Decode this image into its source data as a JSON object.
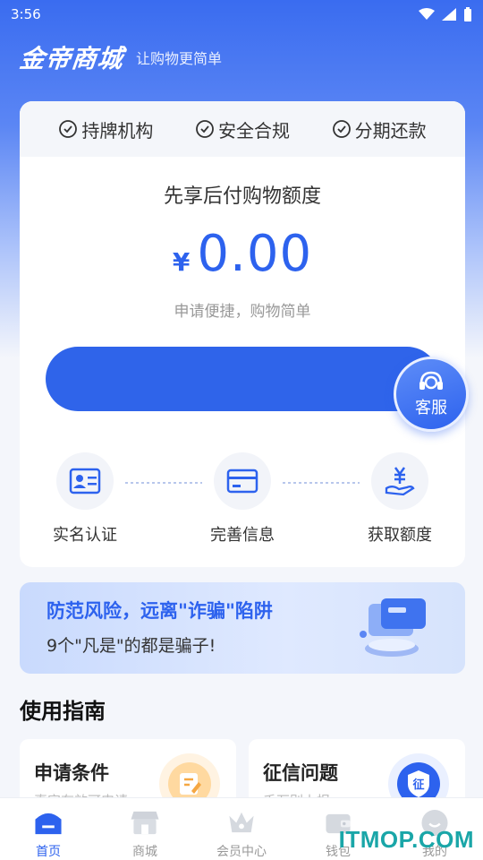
{
  "status_bar": {
    "time": "3:56"
  },
  "header": {
    "logo": "金帝商城",
    "slogan": "让购物更简单"
  },
  "badges": [
    "持牌机构",
    "安全合规",
    "分期还款"
  ],
  "quota": {
    "title": "先享后付购物额度",
    "currency": "¥",
    "amount": "0.00",
    "subtitle": "申请便捷，购物简单"
  },
  "service": {
    "label": "客服"
  },
  "steps": [
    {
      "label": "实名认证",
      "icon": "id-card-icon"
    },
    {
      "label": "完善信息",
      "icon": "card-icon"
    },
    {
      "label": "获取额度",
      "icon": "yen-hand-icon"
    }
  ],
  "warning": {
    "title": "防范风险，远离\"诈骗\"陷阱",
    "subtitle": "9个\"凡是\"的都是骗子!"
  },
  "guide": {
    "title": "使用指南",
    "cards": [
      {
        "title": "申请条件",
        "subtitle": "真实有效可申请",
        "icon": "edit-doc-icon"
      },
      {
        "title": "征信问题",
        "subtitle": "千万别上报",
        "icon": "credit-shield-icon"
      }
    ]
  },
  "tabs": [
    {
      "label": "首页",
      "icon": "home-icon",
      "active": true
    },
    {
      "label": "商城",
      "icon": "shop-icon",
      "active": false
    },
    {
      "label": "会员中心",
      "icon": "crown-icon",
      "active": false
    },
    {
      "label": "钱包",
      "icon": "wallet-icon",
      "active": false
    },
    {
      "label": "我的",
      "icon": "profile-icon",
      "active": false
    }
  ],
  "watermark": "ITMOP.COM",
  "colors": {
    "primary": "#2d62ee",
    "hero_top": "#3a6cf0"
  }
}
